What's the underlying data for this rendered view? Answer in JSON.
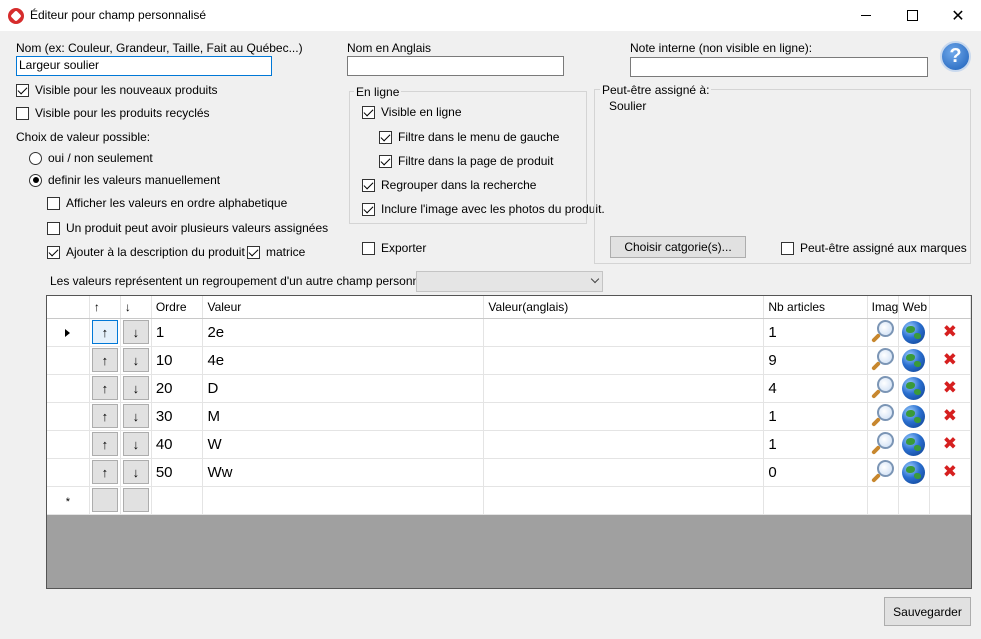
{
  "window": {
    "title": "Éditeur pour champ personnalisé",
    "close_glyph": "✕"
  },
  "fields": {
    "name_label": "Nom (ex: Couleur, Grandeur, Taille, Fait au Québec...)",
    "name_value": "Largeur soulier",
    "english_label": "Nom en Anglais",
    "english_value": "",
    "note_label": "Note interne (non visible en ligne):",
    "note_value": ""
  },
  "help": {
    "glyph": "?"
  },
  "options": {
    "visible_new": {
      "label": "Visible pour les nouveaux produits",
      "checked": true
    },
    "visible_recycled": {
      "label": "Visible pour les produits recyclés",
      "checked": false
    },
    "choice_label": "Choix de valeur possible:",
    "radio_yes_no": {
      "label": "oui / non seulement",
      "selected": false
    },
    "radio_manual": {
      "label": "definir les valeurs manuellement",
      "selected": true
    },
    "alphabetical": {
      "label": "Afficher les valeurs en ordre alphabetique",
      "checked": false
    },
    "multiple_values": {
      "label": "Un produit peut avoir plusieurs valeurs assignées",
      "checked": false
    },
    "add_description": {
      "label": "Ajouter à la description du produit",
      "checked": true
    },
    "matrix": {
      "label": "matrice",
      "checked": true
    }
  },
  "online": {
    "title": "En ligne",
    "visible_online": {
      "label": "Visible en ligne",
      "checked": true
    },
    "filter_left_menu": {
      "label": "Filtre dans le menu de gauche",
      "checked": true
    },
    "filter_product_page": {
      "label": "Filtre dans la page de produit",
      "checked": true
    },
    "group_search": {
      "label": "Regrouper dans la recherche",
      "checked": true
    },
    "include_image": {
      "label": "Inclure l'image avec les photos du produit.",
      "checked": true
    }
  },
  "export": {
    "label": "Exporter",
    "checked": false
  },
  "assign": {
    "title": "Peut-être assigné à:",
    "value": "Soulier",
    "choose_button": "Choisir catgorie(s)...",
    "brands": {
      "label": "Peut-être assigné aux marques",
      "checked": false
    }
  },
  "grouping": {
    "label": "Les valeurs représentent un regroupement d'un autre champ personnalisé:",
    "value": ""
  },
  "grid": {
    "headers": [
      "↑",
      "↓",
      "Ordre",
      "Valeur",
      "Valeur(anglais)",
      "Nb articles",
      "Imag",
      "Web",
      ""
    ],
    "up_glyph": "↑",
    "down_glyph": "↓",
    "delete_glyph": "✖",
    "new_row_glyph": "*",
    "rows": [
      {
        "order": "1",
        "value": "2e",
        "value_en": "",
        "count": "1"
      },
      {
        "order": "10",
        "value": "4e",
        "value_en": "",
        "count": "9"
      },
      {
        "order": "20",
        "value": "D",
        "value_en": "",
        "count": "4"
      },
      {
        "order": "30",
        "value": "M",
        "value_en": "",
        "count": "1"
      },
      {
        "order": "40",
        "value": "W",
        "value_en": "",
        "count": "1"
      },
      {
        "order": "50",
        "value": "Ww",
        "value_en": "",
        "count": "0"
      }
    ]
  },
  "save_button": "Sauvegarder"
}
